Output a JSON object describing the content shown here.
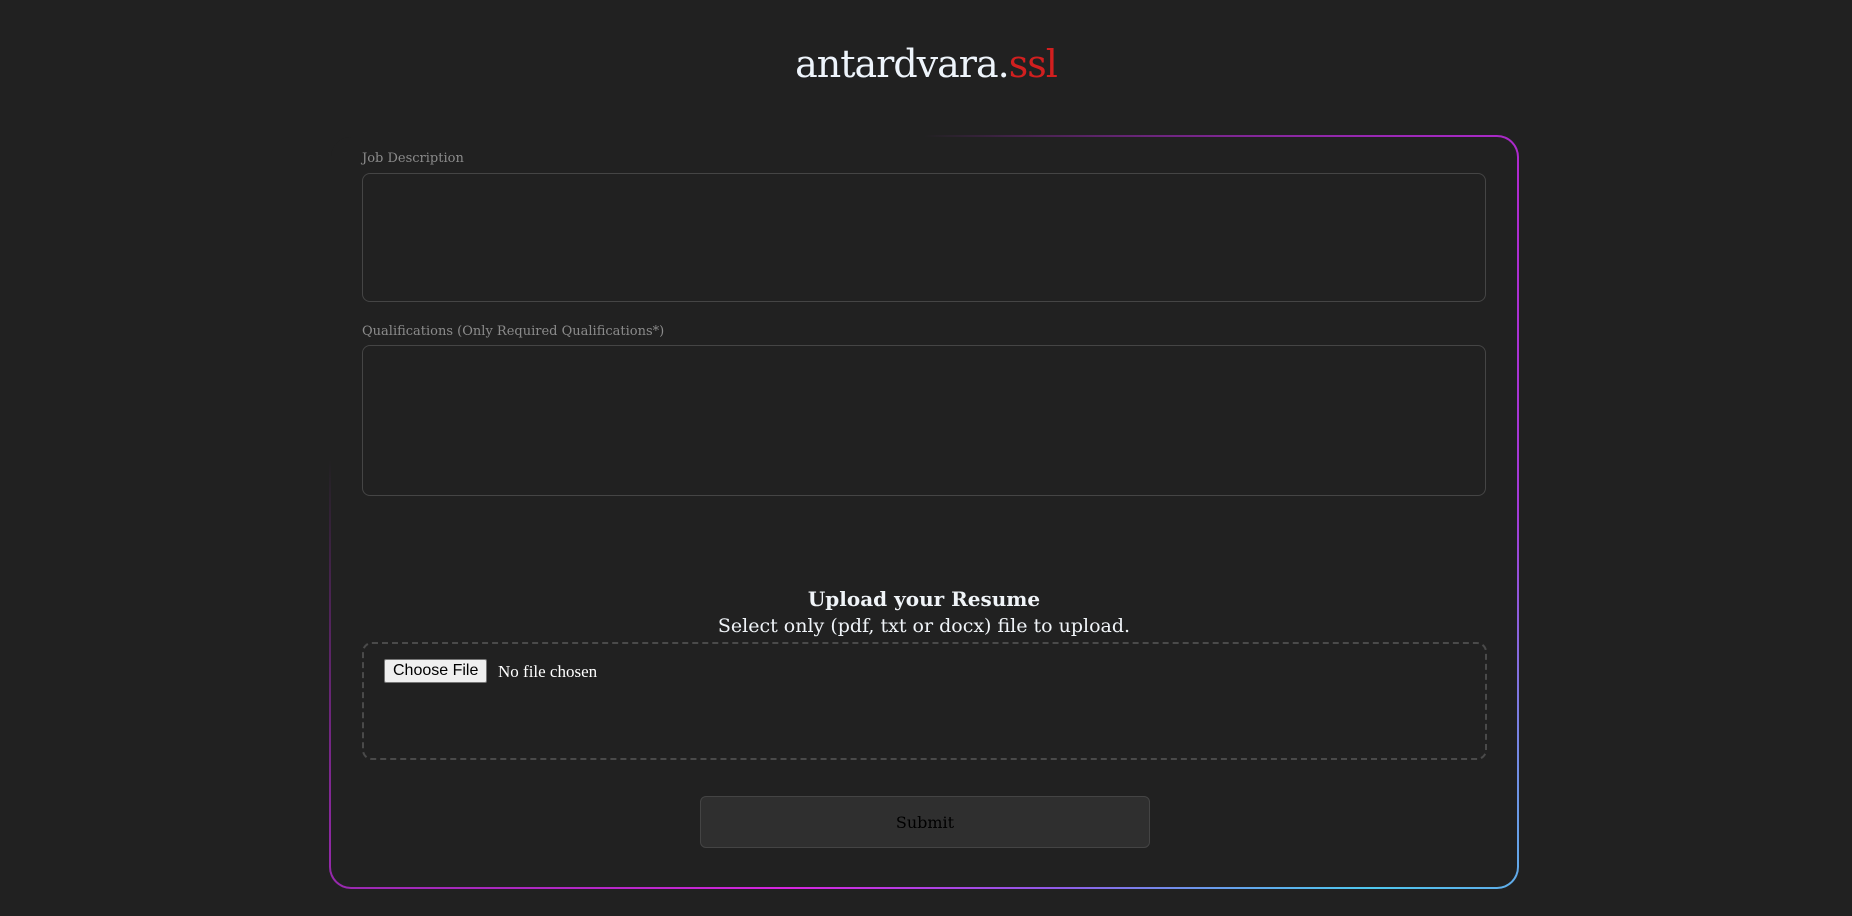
{
  "header": {
    "logo_main": "antardvara.",
    "logo_accent": "ssl"
  },
  "form": {
    "job_description": {
      "label": "Job Description",
      "value": ""
    },
    "qualifications": {
      "label": "Qualifications (Only Required Qualifications*)",
      "value": ""
    },
    "upload": {
      "title": "Upload your Resume",
      "subtitle": "Select only (pdf, txt or docx) file to upload.",
      "choose_file_label": "Choose File",
      "file_status": "No file chosen"
    },
    "submit_label": "Submit"
  },
  "colors": {
    "background": "#212121",
    "accent": "#d11f1f",
    "border_gradient": [
      "#b02ad0",
      "#4fc8ee",
      "#d626e0"
    ]
  }
}
